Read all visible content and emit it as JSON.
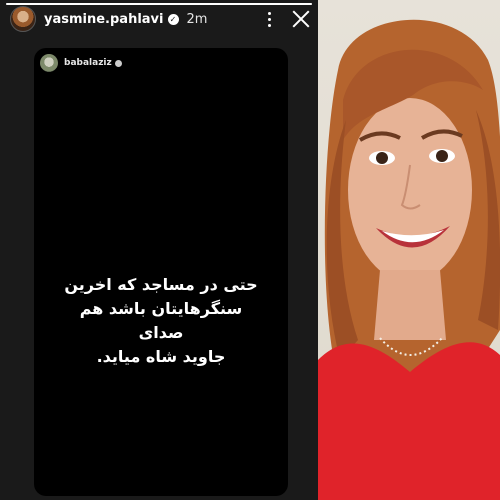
{
  "story": {
    "username": "yasmine.pahlavi",
    "timestamp": "2m",
    "progress": 1.0
  },
  "shared_post": {
    "username": "babalaziz",
    "text_lines": [
      "حتی در مساجد که اخرین",
      "سنگرهایتان باشد هم",
      "صدای",
      "جاوید شاه میاید."
    ]
  },
  "icons": {
    "more": "more-options-icon",
    "close": "close-icon",
    "verified": "verified-badge-icon"
  },
  "colors": {
    "story_background": "#1a1a1a",
    "card_background": "#000000",
    "text": "#ffffff",
    "photo_shirt": "#e0232a"
  }
}
